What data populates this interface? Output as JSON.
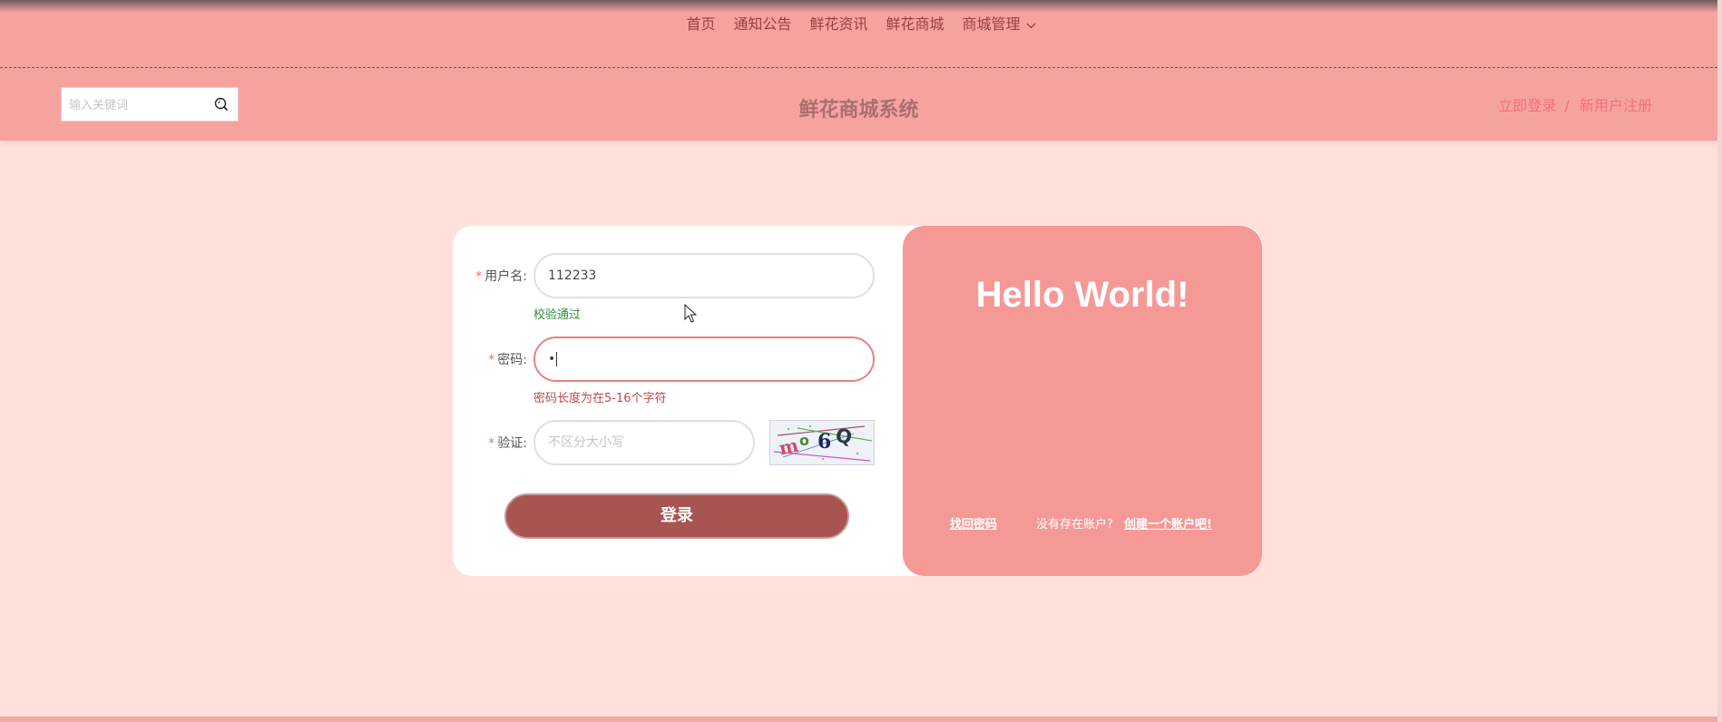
{
  "nav": {
    "items": [
      "首页",
      "通知公告",
      "鲜花资讯",
      "鲜花商城",
      "商城管理"
    ]
  },
  "header": {
    "search_placeholder": "输入关键词",
    "title": "鲜花商城系统",
    "login_link": "立即登录",
    "separator": "/",
    "register_link": "新用户注册"
  },
  "form": {
    "required_mark": "*",
    "username_label": "用户名:",
    "username_value": "112233",
    "username_hint": "校验通过",
    "password_label": "密码:",
    "password_value": "•",
    "password_error": "密码长度为在5-16个字符",
    "captcha_label": "验证:",
    "captcha_placeholder": "不区分大小写",
    "captcha_text": "m o 6 Q",
    "login_button": "登录"
  },
  "panel": {
    "greeting": "Hello World!",
    "forgot_password": "找回密码",
    "no_account": "没有存在账户?",
    "create_account": "创建一个账户吧!"
  },
  "colors": {
    "header_bg": "#f6a3a0",
    "page_bg": "#ffe0db",
    "button_bg": "#a85552",
    "panel_bg": "#f59997",
    "error": "#c0484a",
    "success": "#2f8f3a"
  }
}
